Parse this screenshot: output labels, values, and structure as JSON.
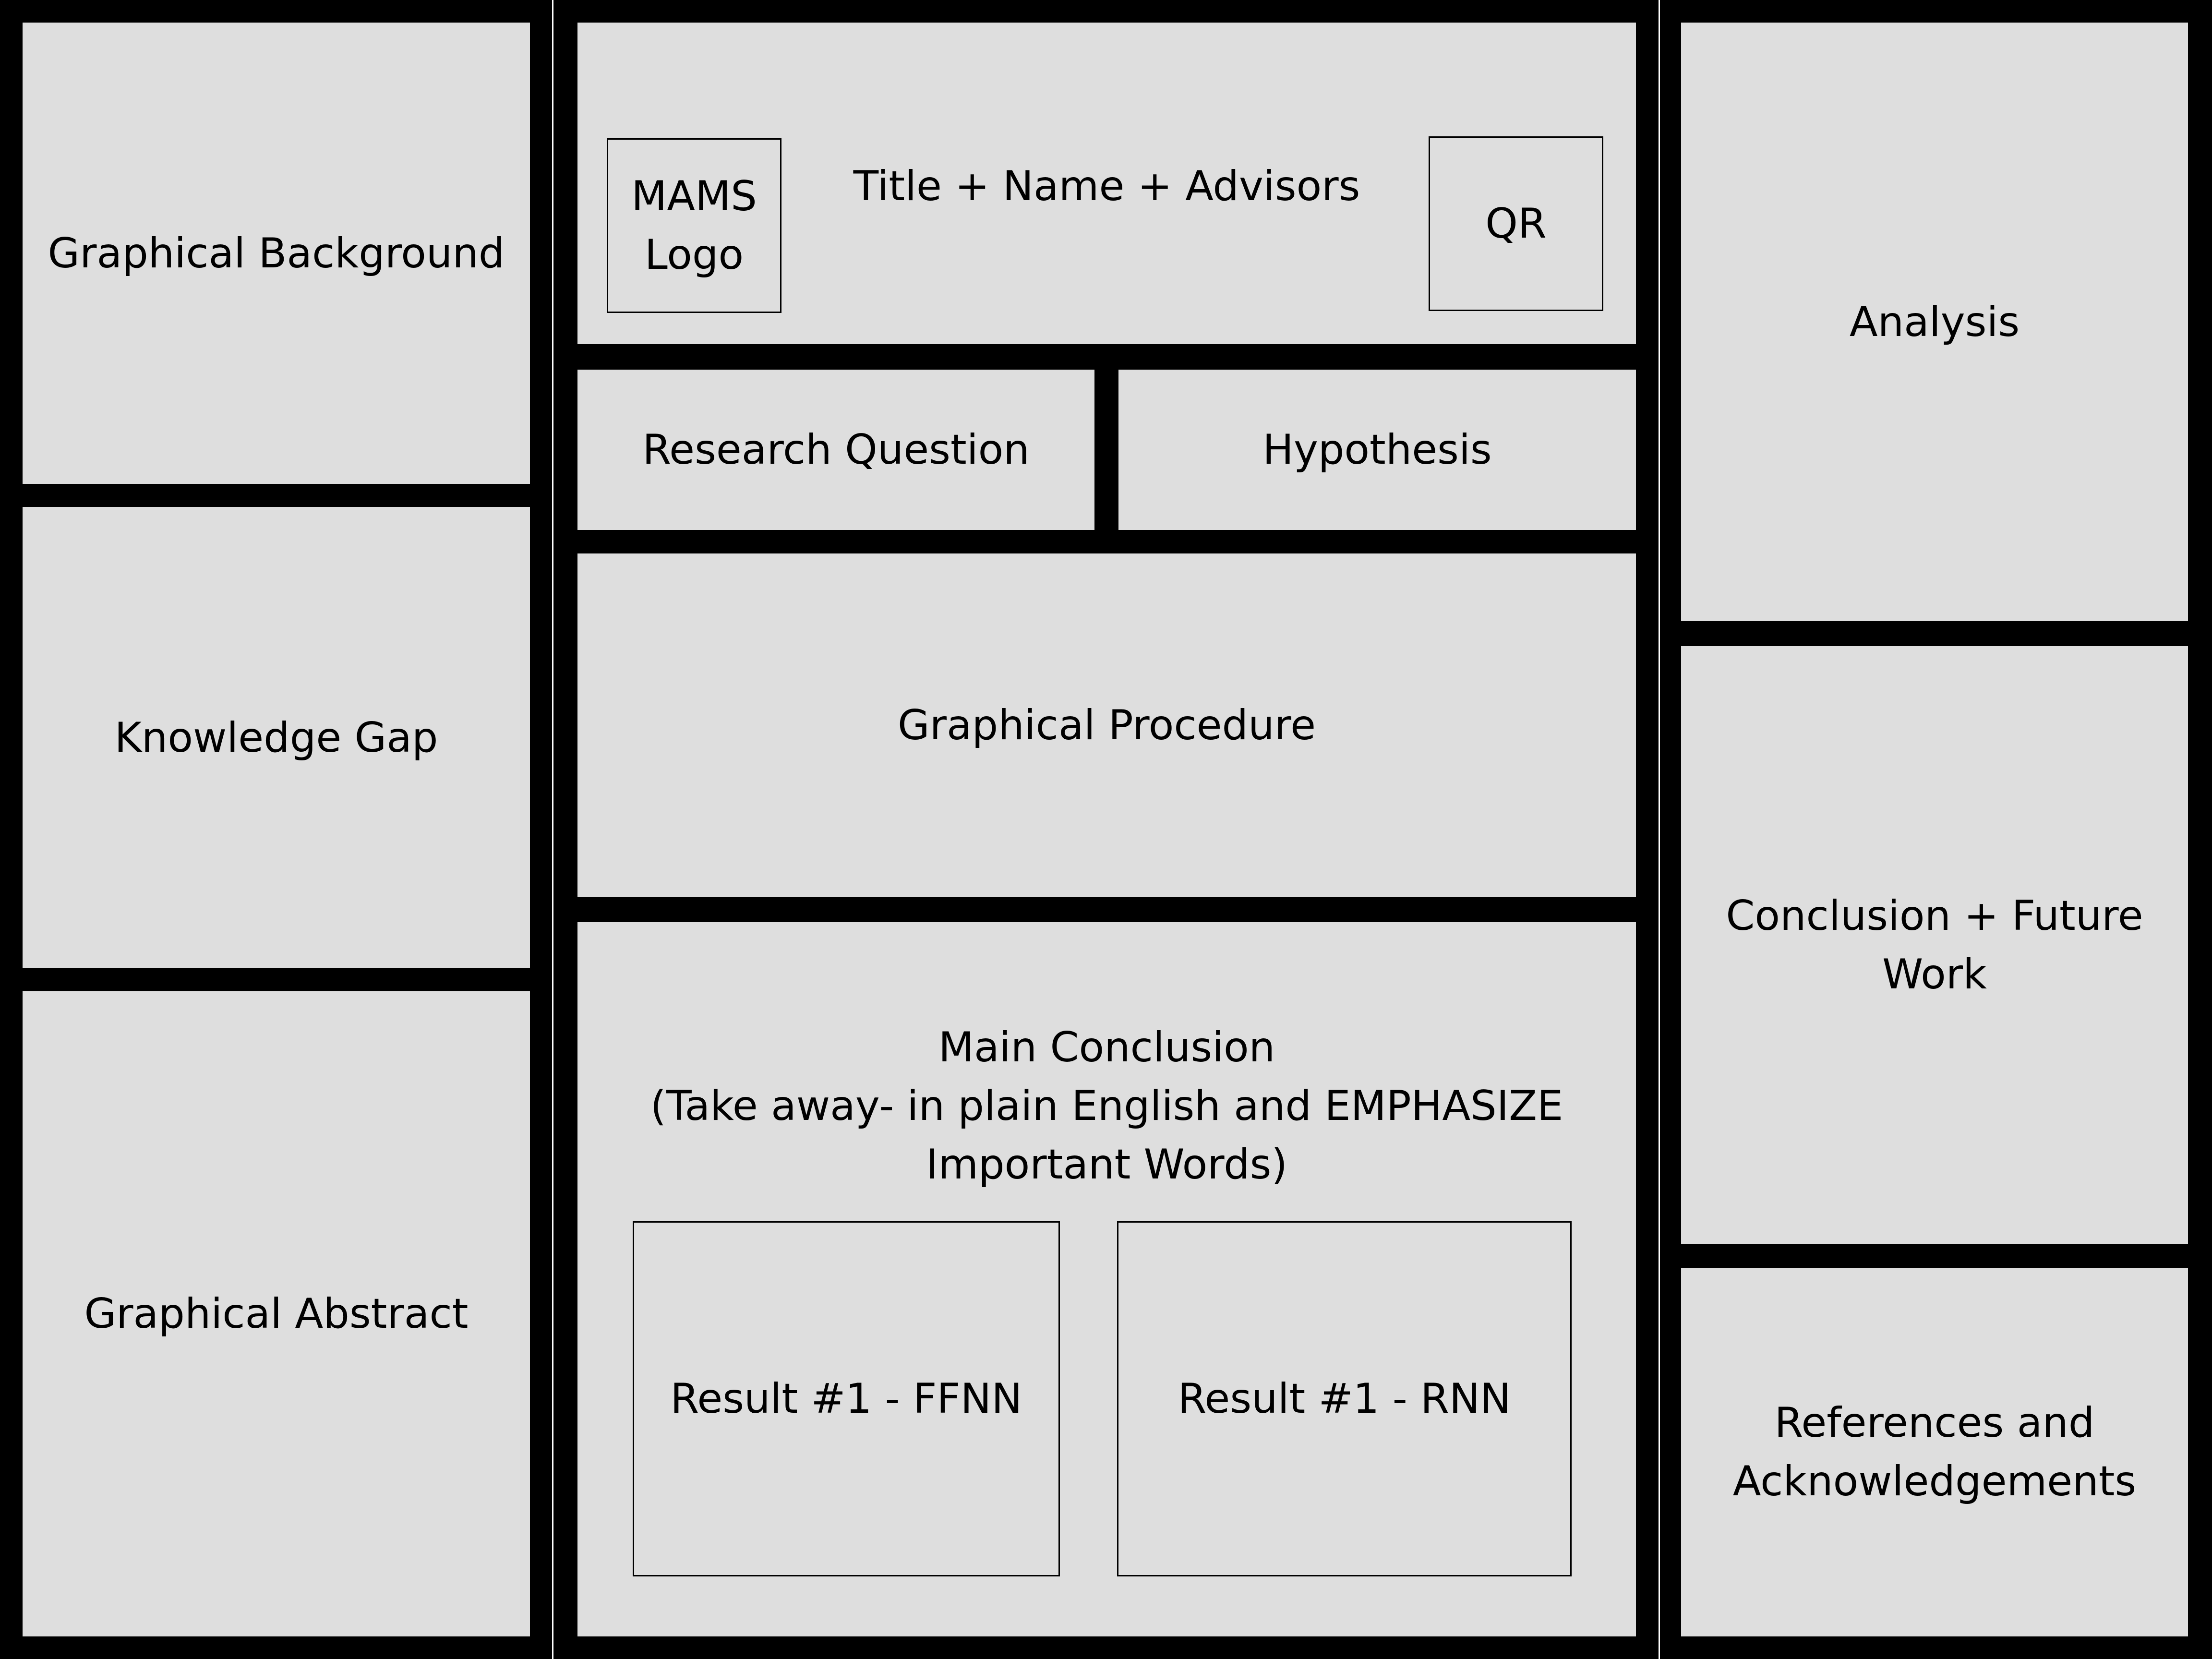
{
  "panels": {
    "graphical_background": "Graphical Background",
    "knowledge_gap": "Knowledge Gap",
    "graphical_abstract": "Graphical Abstract",
    "title_block": "Title + Name + Advisors",
    "mams_logo": "MAMS\nLogo",
    "qr": "QR",
    "research_question": "Research Question",
    "hypothesis": "Hypothesis",
    "graphical_procedure": "Graphical Procedure",
    "main_conclusion": "Main Conclusion\n(Take away- in plain English and EMPHASIZE\nImportant Words)",
    "result_ffnn": "Result #1 - FFNN",
    "result_rnn": "Result #1 - RNN",
    "analysis": "Analysis",
    "conclusion_future_work": "Conclusion + Future\nWork",
    "references": "References and\nAcknowledgements"
  },
  "colors": {
    "background": "#000000",
    "panel": "#dedede",
    "divider": "#ffffff"
  }
}
